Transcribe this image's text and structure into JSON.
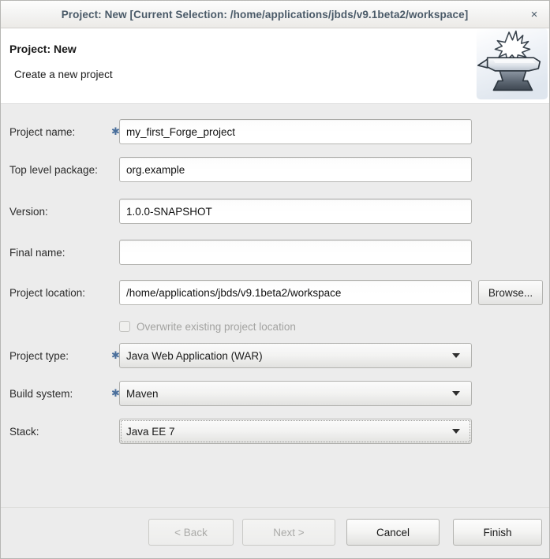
{
  "window": {
    "title": "Project: New [Current Selection: /home/applications/jbds/v9.1beta2/workspace]",
    "close_label": "×"
  },
  "header": {
    "title": "Project: New",
    "subtitle": "Create a new project",
    "logo_icon": "anvil-icon"
  },
  "form": {
    "project_name": {
      "label": "Project name:",
      "required_marker": "✱",
      "value": "my_first_Forge_project",
      "placeholder": ""
    },
    "top_level_package": {
      "label": "Top level package:",
      "value": "org.example",
      "placeholder": ""
    },
    "version": {
      "label": "Version:",
      "value": "1.0.0-SNAPSHOT",
      "placeholder": ""
    },
    "final_name": {
      "label": "Final name:",
      "value": "",
      "placeholder": ""
    },
    "project_location": {
      "label": "Project location:",
      "value": "/home/applications/jbds/v9.1beta2/workspace",
      "placeholder": "",
      "browse_label": "Browse..."
    },
    "overwrite": {
      "label": "Overwrite existing project location",
      "checked": false,
      "enabled": false
    },
    "project_type": {
      "label": "Project type:",
      "required_marker": "✱",
      "value": "Java Web Application (WAR)"
    },
    "build_system": {
      "label": "Build system:",
      "required_marker": "✱",
      "value": "Maven"
    },
    "stack": {
      "label": "Stack:",
      "value": "Java EE 7",
      "focused": true
    }
  },
  "footer": {
    "back_label": "< Back",
    "next_label": "Next >",
    "cancel_label": "Cancel",
    "finish_label": "Finish"
  },
  "colors": {
    "window_background": "#ececec",
    "header_background": "#ffffff",
    "title_text": "#4a5a68",
    "required_marker": "#4a6f9c",
    "disabled_text": "#a3a3a1"
  }
}
